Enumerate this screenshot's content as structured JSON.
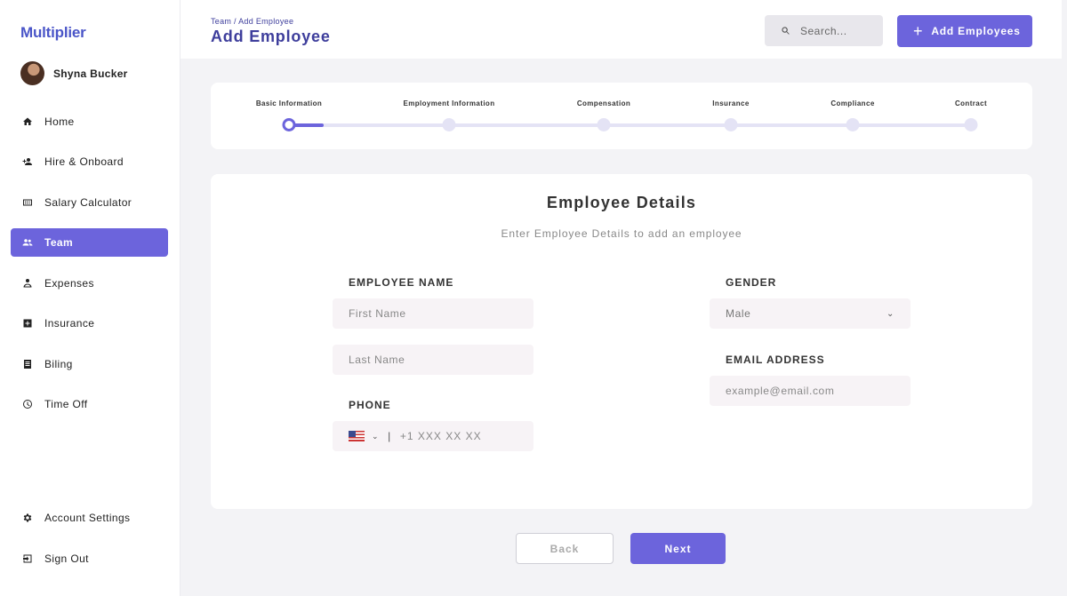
{
  "app": {
    "logo": "Multiplier"
  },
  "profile": {
    "name": "Shyna Bucker"
  },
  "sidebar": {
    "items": [
      {
        "label": "Home",
        "icon": "home-icon",
        "active": false
      },
      {
        "label": "Hire & Onboard",
        "icon": "person-add-icon",
        "active": false
      },
      {
        "label": "Salary Calculator",
        "icon": "calculator-icon",
        "active": false
      },
      {
        "label": "Team",
        "icon": "people-icon",
        "active": true
      },
      {
        "label": "Expenses",
        "icon": "receipt-icon",
        "active": false
      },
      {
        "label": "Insurance",
        "icon": "medical-cross-icon",
        "active": false
      },
      {
        "label": "Biling",
        "icon": "document-icon",
        "active": false
      },
      {
        "label": "Time Off",
        "icon": "clock-icon",
        "active": false
      }
    ],
    "bottom_items": [
      {
        "label": "Account Settings",
        "icon": "gear-icon"
      },
      {
        "label": "Sign Out",
        "icon": "sign-out-icon"
      }
    ]
  },
  "header": {
    "breadcrumb": "Team / Add Employee",
    "title": "Add Employee",
    "search_placeholder": "Search...",
    "add_button": "Add Employees"
  },
  "stepper": {
    "steps": [
      "Basic Information",
      "Employment Information",
      "Compensation",
      "Insurance",
      "Compliance",
      "Contract"
    ],
    "current_step": 1
  },
  "form": {
    "title": "Employee Details",
    "subtitle": "Enter Employee Details to add an employee",
    "employee_name_label": "EMPLOYEE NAME",
    "first_name_placeholder": "First Name",
    "last_name_placeholder": "Last Name",
    "phone_label": "PHONE",
    "phone_placeholder": "+1 XXX XX XX",
    "gender_label": "GENDER",
    "gender_value": "Male",
    "email_label": "EMAIL ADDRESS",
    "email_placeholder": "example@email.com"
  },
  "footer": {
    "back": "Back",
    "next": "Next"
  },
  "colors": {
    "accent": "#6c64dc",
    "title": "#3e3e9c"
  }
}
